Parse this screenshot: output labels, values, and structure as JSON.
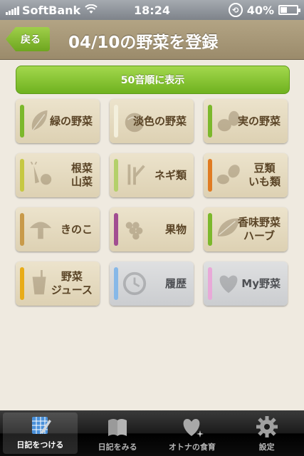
{
  "status_bar": {
    "carrier": "SoftBank",
    "time": "18:24",
    "battery": "40%",
    "battery_level": 0.4
  },
  "header": {
    "back_label": "戻る",
    "title": "04/10の野菜を登録"
  },
  "sort_button_label": "50音順に表示",
  "categories": [
    {
      "label": "緑の野菜",
      "stripe": "#7cb82c",
      "icon": "leaf-vegetable-icon",
      "style": "beige"
    },
    {
      "label": "淡色の野菜",
      "stripe": "#f3efdc",
      "icon": "pale-vegetable-icon",
      "style": "beige"
    },
    {
      "label": "実の野菜",
      "stripe": "#7cb82c",
      "icon": "fruit-vegetable-icon",
      "style": "beige"
    },
    {
      "label": "根菜\n山菜",
      "stripe": "#c6c842",
      "icon": "root-vegetable-icon",
      "style": "beige"
    },
    {
      "label": "ネギ類",
      "stripe": "#b4d06a",
      "icon": "green-onion-icon",
      "style": "beige"
    },
    {
      "label": "豆類\nいも類",
      "stripe": "#e07b22",
      "icon": "bean-potato-icon",
      "style": "beige"
    },
    {
      "label": "きのこ",
      "stripe": "#c89a4a",
      "icon": "mushroom-icon",
      "style": "beige"
    },
    {
      "label": "果物",
      "stripe": "#a24e91",
      "icon": "grape-icon",
      "style": "beige"
    },
    {
      "label": "香味野菜\nハーブ",
      "stripe": "#7cb82c",
      "icon": "herb-leaf-icon",
      "style": "beige"
    },
    {
      "label": "野菜\nジュース",
      "stripe": "#e8ac18",
      "icon": "juice-icon",
      "style": "beige"
    },
    {
      "label": "履歴",
      "stripe": "#86b8e8",
      "icon": "clock-icon",
      "style": "gray"
    },
    {
      "label": "My野菜",
      "stripe": "#e8a9d8",
      "icon": "heart-icon",
      "style": "gray"
    }
  ],
  "tabs": [
    {
      "label": "日記をつける",
      "icon": "diary-write-icon",
      "active": true
    },
    {
      "label": "日記をみる",
      "icon": "book-icon",
      "active": false
    },
    {
      "label": "オトナの食育",
      "icon": "heart-sparkle-icon",
      "active": false
    },
    {
      "label": "設定",
      "icon": "gear-icon",
      "active": false
    }
  ]
}
